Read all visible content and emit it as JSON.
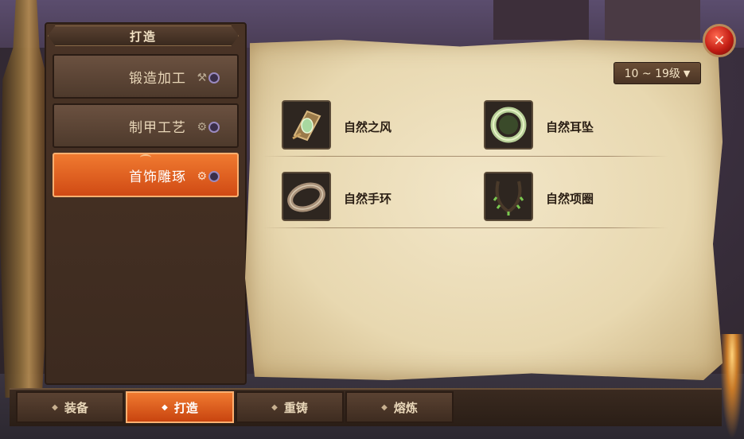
{
  "window": {
    "title": "打造"
  },
  "sidebar": {
    "items": [
      {
        "label": "锻造加工",
        "active": false,
        "icon": "anvil-icon"
      },
      {
        "label": "制甲工艺",
        "active": false,
        "icon": "armor-craft-icon"
      },
      {
        "label": "首饰雕琢",
        "active": true,
        "icon": "jewelry-craft-icon"
      }
    ]
  },
  "filter": {
    "level_range": "10 ~ 19级"
  },
  "items": [
    {
      "name": "自然之风",
      "icon": "wind-charm-icon"
    },
    {
      "name": "自然耳坠",
      "icon": "earring-icon"
    },
    {
      "name": "自然手环",
      "icon": "bracelet-icon"
    },
    {
      "name": "自然项圈",
      "icon": "necklace-icon"
    }
  ],
  "tabs": [
    {
      "label": "装备",
      "active": false
    },
    {
      "label": "打造",
      "active": true
    },
    {
      "label": "重铸",
      "active": false
    },
    {
      "label": "熔炼",
      "active": false
    }
  ],
  "colors": {
    "accent": "#e8621f",
    "parchment": "#f2e6c8",
    "close": "#c41e14"
  }
}
